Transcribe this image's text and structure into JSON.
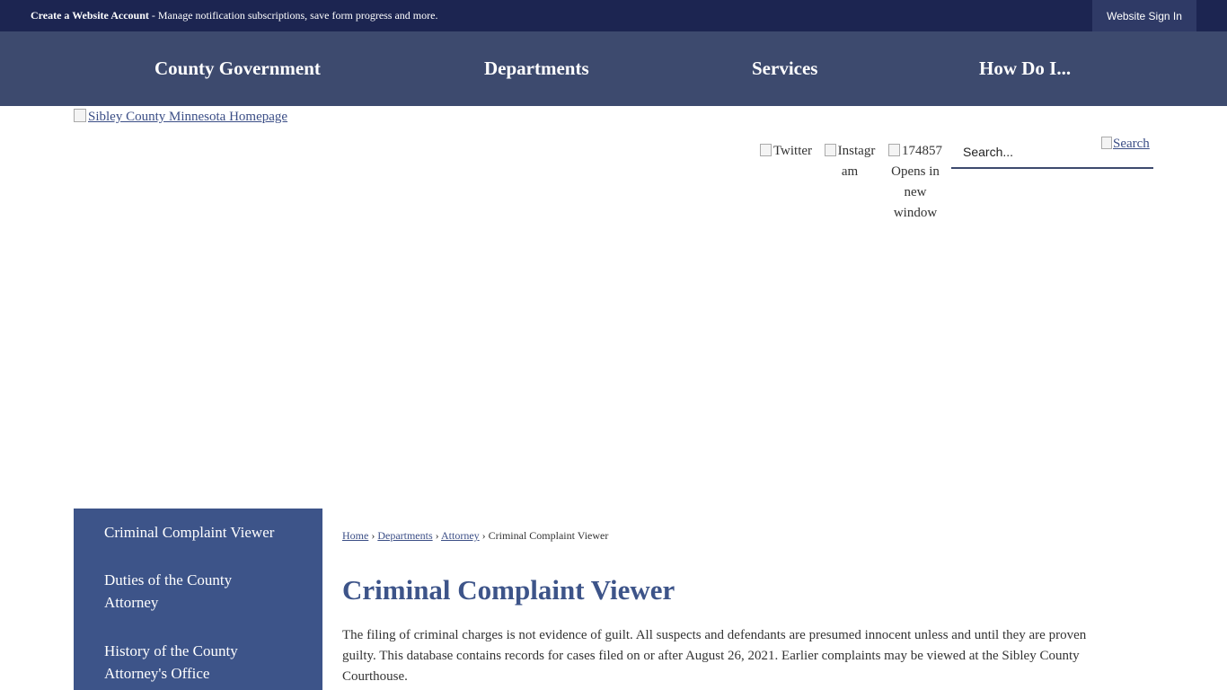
{
  "topbar": {
    "account_title": "Create a Website Account",
    "account_desc": " - Manage notification subscriptions, save form progress and more.",
    "signin_label": "Website Sign In"
  },
  "nav": {
    "items": [
      "County Government",
      "Departments",
      "Services",
      "How Do I..."
    ]
  },
  "header": {
    "logo_alt": "Sibley County Minnesota Homepage",
    "social": {
      "twitter": "Twitter",
      "instagram_1": "Instagr",
      "instagram_2": "am",
      "facebook_1": "174857",
      "facebook_2": "Opens in",
      "facebook_3": "new",
      "facebook_4": "window"
    },
    "search_placeholder": "Search...",
    "search_button": "Search"
  },
  "sidebar": {
    "items": [
      {
        "line1": "Criminal Complaint Viewer",
        "line2": ""
      },
      {
        "line1": "Duties of the County",
        "line2": "Attorney"
      },
      {
        "line1": "History of the County",
        "line2": "Attorney's Office"
      }
    ]
  },
  "breadcrumb": {
    "home": "Home",
    "departments": "Departments",
    "attorney": "Attorney",
    "current": "Criminal Complaint Viewer",
    "separator": "›"
  },
  "main": {
    "title": "Criminal Complaint Viewer",
    "intro": "The filing of criminal charges is not evidence of guilt. All suspects and defendants are presumed innocent unless and until they are proven guilty. This database contains records for cases filed on or after August 26, 2021. Earlier complaints may be viewed at the Sibley County Courthouse."
  },
  "colors": {
    "topbar_bg": "#1c2551",
    "nav_bg": "#3d4a6e",
    "sidebar_bg": "#3d5489",
    "title": "#3d5489"
  }
}
